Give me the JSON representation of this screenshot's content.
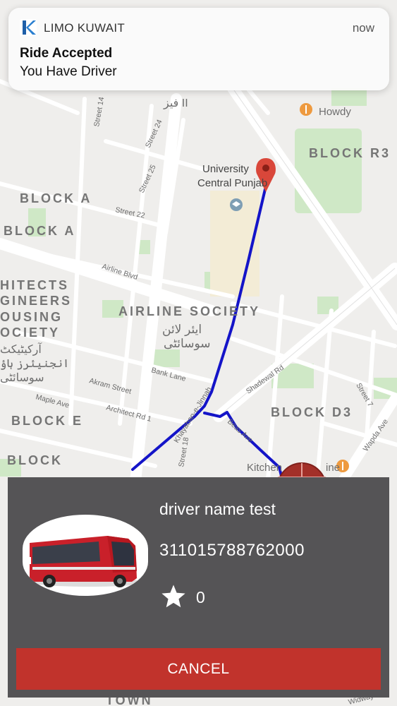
{
  "notification": {
    "app_name": "LIMO KUWAIT",
    "time": "now",
    "title": "Ride Accepted",
    "body": "You Have Driver",
    "app_icon": "k-logo-icon"
  },
  "map": {
    "area_labels": {
      "block_a_1": "BLOCK A",
      "block_a_2": "BLOCK A",
      "block_r3": "BLOCK R3",
      "block_d3": "BLOCK D3",
      "block_e": "BLOCK E",
      "block": "BLOCK",
      "airline_society": "AIRLINE SOCIETY",
      "airline_society_urdu_1": "ایئر لائن",
      "airline_society_urdu_2": "سوسائٹی",
      "architects_1": "HITECTS",
      "architects_2": "GINEERS",
      "architects_3": "OUSING",
      "architects_4": "OCIETY",
      "architects_urdu_1": "آرکیٹیکٹ",
      "architects_urdu_2": "انجنیئرز ہاؤ",
      "architects_urdu_3": "سوسائٹی",
      "faiz_urdu": "فیز II",
      "town": "TOWN"
    },
    "poi_labels": {
      "university_1": "University",
      "university_2": "Central Punjab",
      "howdy": "Howdy",
      "kitchen": "Kitchen",
      "kitchen_suffix": "ine"
    },
    "street_labels": {
      "street_14": "Street 14",
      "street_24": "Street 24",
      "street_25": "Street 25",
      "street_22": "Street 22",
      "airline_blvd": "Airline Blvd",
      "bank_lane": "Bank Lane",
      "akram_street": "Akram Street",
      "maple_ave": "Maple Ave",
      "architect_rd": "Architect Rd 1",
      "street_18": "Street 18",
      "khayaban": "Khayaban-e-Jinnah",
      "beas_ave": "Beas Ave",
      "shadewal_rd": "Shadewal Rd",
      "street_7": "Street 7",
      "wapda_ave": "Wapda Ave",
      "widway": "Widway"
    },
    "route_color": "#1414c8",
    "pin_color": "#d9473a",
    "pin_icon": "map-pin-icon"
  },
  "driver_card": {
    "name": "driver name test",
    "phone": "311015788762000",
    "rating_icon": "star-icon",
    "rating": "0",
    "vehicle_icon": "bus-icon",
    "cancel_label": "CANCEL",
    "cancel_color": "#c1332c"
  }
}
